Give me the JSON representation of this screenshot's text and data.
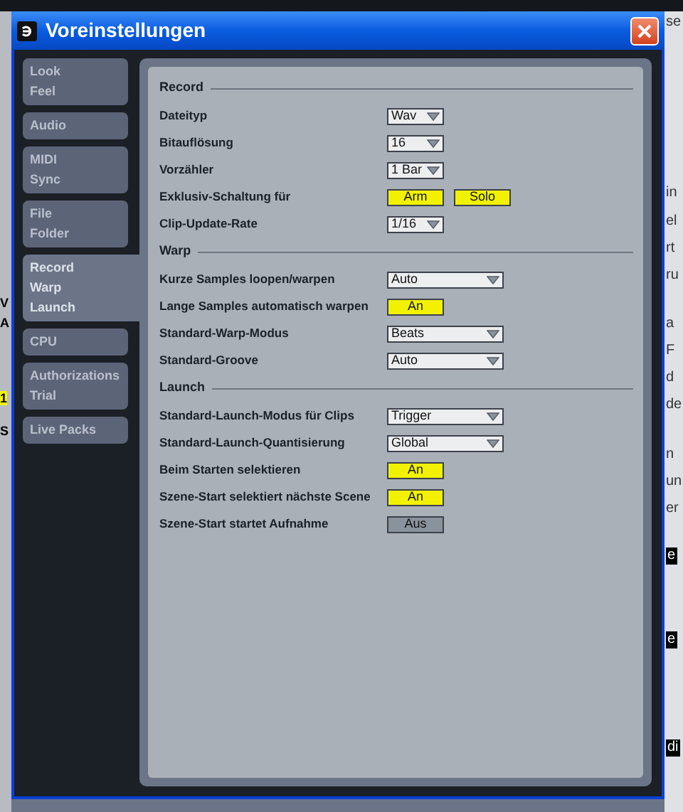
{
  "window": {
    "title": "Voreinstellungen"
  },
  "sidebar": {
    "tabs": [
      {
        "lines": [
          "Look",
          "Feel"
        ],
        "selected": false
      },
      {
        "lines": [
          "Audio"
        ],
        "selected": false
      },
      {
        "lines": [
          "MIDI",
          "Sync"
        ],
        "selected": false
      },
      {
        "lines": [
          "File",
          "Folder"
        ],
        "selected": false
      },
      {
        "lines": [
          "Record",
          "Warp",
          "Launch"
        ],
        "selected": true
      },
      {
        "lines": [
          "CPU"
        ],
        "selected": false
      },
      {
        "lines": [
          "Authorizations",
          "Trial"
        ],
        "selected": false
      },
      {
        "lines": [
          "Live Packs"
        ],
        "selected": false
      }
    ]
  },
  "sections": [
    {
      "title": "Record",
      "rows": [
        {
          "label": "Dateityp",
          "kind": "select",
          "value": "Wav"
        },
        {
          "label": "Bitauflösung",
          "kind": "select",
          "value": "16"
        },
        {
          "label": "Vorzähler",
          "kind": "select",
          "value": "1 Bar"
        },
        {
          "label": "Exklusiv-Schaltung für",
          "kind": "toggle",
          "buttons": [
            {
              "text": "Arm",
              "on": true
            },
            {
              "text": "Solo",
              "on": true
            }
          ]
        },
        {
          "label": "Clip-Update-Rate",
          "kind": "select",
          "value": "1/16"
        }
      ]
    },
    {
      "title": "Warp",
      "rows": [
        {
          "label": "Kurze Samples loopen/warpen",
          "kind": "select",
          "value": "Auto"
        },
        {
          "label": "Lange Samples automatisch warpen",
          "kind": "toggle",
          "buttons": [
            {
              "text": "An",
              "on": true
            }
          ]
        },
        {
          "label": "Standard-Warp-Modus",
          "kind": "select",
          "value": "Beats"
        },
        {
          "label": "Standard-Groove",
          "kind": "select",
          "value": "Auto"
        }
      ]
    },
    {
      "title": "Launch",
      "rows": [
        {
          "label": "Standard-Launch-Modus für Clips",
          "kind": "select",
          "value": "Trigger"
        },
        {
          "label": "Standard-Launch-Quantisierung",
          "kind": "select",
          "value": "Global"
        },
        {
          "label": "Beim Starten selektieren",
          "kind": "toggle",
          "buttons": [
            {
              "text": "An",
              "on": true
            }
          ]
        },
        {
          "label": "Szene-Start selektiert nächste Scene",
          "kind": "toggle",
          "buttons": [
            {
              "text": "An",
              "on": true
            }
          ]
        },
        {
          "label": "Szene-Start startet Aufnahme",
          "kind": "toggle",
          "buttons": [
            {
              "text": "Aus",
              "on": false
            }
          ]
        }
      ]
    }
  ],
  "background": {
    "left_fragments": [
      "V",
      "A",
      "1",
      "S"
    ],
    "right_fragments": [
      "se",
      "in",
      "el",
      "rt",
      "ru",
      "a",
      "F",
      "d",
      "de",
      "n",
      "un",
      "er",
      "e",
      "e",
      "di"
    ]
  }
}
